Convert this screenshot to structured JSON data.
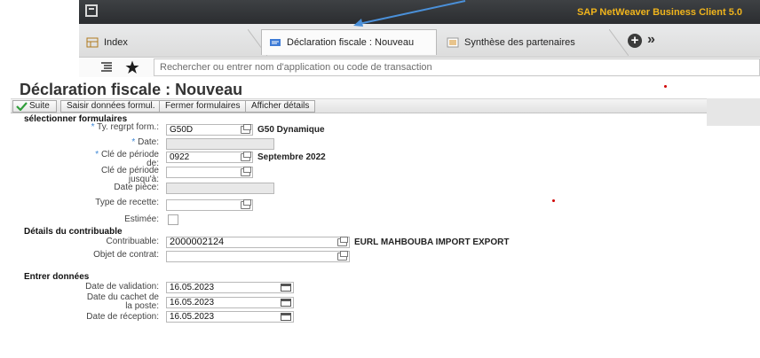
{
  "app": {
    "brand": "SAP NetWeaver Business Client 5.0"
  },
  "tabs": [
    {
      "label": "Index"
    },
    {
      "label": "Déclaration fiscale : Nouveau"
    },
    {
      "label": "Synthèse des partenaires"
    }
  ],
  "search": {
    "placeholder": "Rechercher ou entrer nom d'application ou code de transaction"
  },
  "page": {
    "title": "Déclaration fiscale : Nouveau"
  },
  "toolbar": {
    "suite_label": "Suite",
    "saisir_label": "Saisir données formul.",
    "fermer_label": "Fermer formulaires",
    "afficher_label": "Afficher détails"
  },
  "form": {
    "section1": "sélectionner formulaires",
    "ty_regrpt_label": "Ty. regrpt form.:",
    "ty_regrpt_value": "G50D",
    "ty_regrpt_desc": "G50 Dynamique",
    "date_label": "Date:",
    "cle_de_label1": "Clé de période",
    "cle_de_label2": "de:",
    "cle_de_value": "0922",
    "cle_de_desc": "Septembre 2022",
    "cle_jusqua_label1": "Clé de période",
    "cle_jusqua_label2": "jusqu'à:",
    "date_piece_label": "Date pièce:",
    "type_recette_label": "Type de recette:",
    "estimee_label": "Estimée:",
    "section2": "Détails du contribuable",
    "contribuable_label": "Contribuable:",
    "contribuable_value": "2000002124",
    "contribuable_desc": "EURL MAHBOUBA IMPORT EXPORT",
    "objet_label": "Objet de contrat:",
    "section3": "Entrer données",
    "date_validation_label": "Date de validation:",
    "date_validation_value": "16.05.2023",
    "date_cachet_label1": "Date du cachet de",
    "date_cachet_label2": "la poste:",
    "date_cachet_value": "16.05.2023",
    "date_reception_label": "Date de réception:",
    "date_reception_value": "16.05.2023"
  },
  "colors": {
    "brand": "#f0b41c",
    "required": "#3d87d6",
    "suite_check": "#2f9e3a",
    "annotation_arrow": "#4a90d9"
  }
}
